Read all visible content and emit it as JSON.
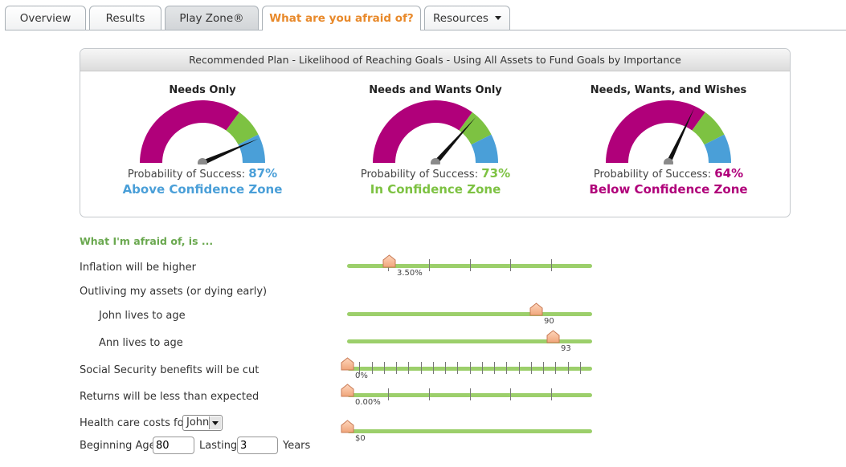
{
  "tabs": [
    {
      "label": "Overview"
    },
    {
      "label": "Results"
    },
    {
      "label": "Play Zone®"
    },
    {
      "label": "What are you afraid of?"
    },
    {
      "label": "Resources"
    }
  ],
  "plan": {
    "header": "Recommended Plan - Likelihood of Reaching Goals - Using All Assets to Fund Goals by Importance",
    "prob_label": "Probability of Success:",
    "gauges": [
      {
        "title": "Needs Only",
        "probability": "87%",
        "zone": "Above Confidence Zone",
        "color": "#4a9fd8"
      },
      {
        "title": "Needs and Wants Only",
        "probability": "73%",
        "zone": "In Confidence Zone",
        "color": "#7dc242"
      },
      {
        "title": "Needs, Wants, and Wishes",
        "probability": "64%",
        "zone": "Below Confidence Zone",
        "color": "#b0007a"
      }
    ],
    "gauge_colors": {
      "below": "#b0007a",
      "in": "#7dc242",
      "above": "#4a9fd8",
      "needle": "#111111"
    }
  },
  "fears": {
    "title": "What I'm afraid of, is ...",
    "inflation": {
      "label": "Inflation will be higher",
      "value": "3.50%",
      "fraction": 0.17
    },
    "outliving": {
      "label": "Outliving my assets (or dying early)"
    },
    "john": {
      "label": "John lives to age",
      "value": "90",
      "fraction": 0.77
    },
    "ann": {
      "label": "Ann lives to age",
      "value": "93",
      "fraction": 0.84
    },
    "social_security": {
      "label": "Social Security benefits will be cut",
      "value": "0%",
      "fraction": 0.0
    },
    "returns": {
      "label": "Returns will be less than expected",
      "value": "0.00%",
      "fraction": 0.0
    },
    "health": {
      "label": "Health care costs for",
      "person": "John",
      "value": "$0",
      "fraction": 0.0,
      "beginning_age_label": "Beginning Age",
      "beginning_age": "80",
      "lasting_label": "Lasting",
      "lasting": "3",
      "years_label": "Years"
    }
  }
}
